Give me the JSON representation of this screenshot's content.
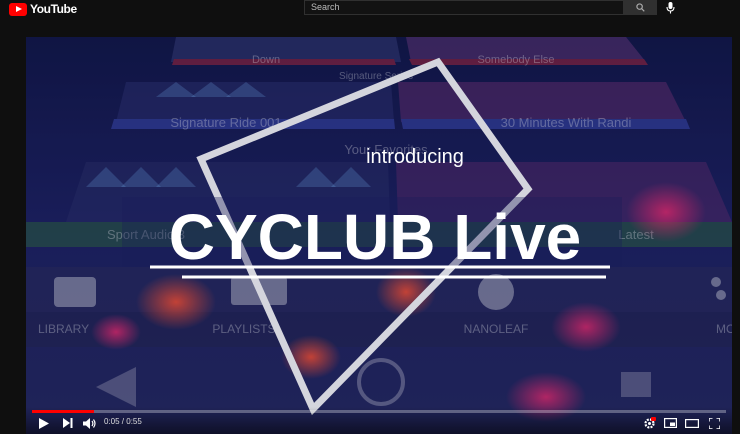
{
  "masthead": {
    "logo_text": "YouTube",
    "search_placeholder": "Search"
  },
  "player": {
    "title_small": "introducing",
    "title_large": "CYCLUB Live",
    "current_time": "0:05",
    "separator": " / ",
    "duration": "0:55",
    "progress_fraction": 0.09
  },
  "background_app": {
    "tiles": [
      "Down",
      "Somebody Else",
      "Signature Series",
      "Signature Ride 001",
      "30 Minutes With Randi",
      "Your Favorites",
      "Sport Audio 3",
      "Latest"
    ],
    "nav": [
      "LIBRARY",
      "PLAYLISTS",
      "NANOLEAF",
      "MORE"
    ]
  },
  "colors": {
    "accent": "#ff0000",
    "overlay": "#1c2060"
  },
  "icons": [
    "youtube-logo-icon",
    "search-icon",
    "mic-icon",
    "play-icon",
    "next-icon",
    "volume-icon",
    "settings-icon",
    "miniplayer-icon",
    "theater-icon",
    "fullscreen-icon"
  ]
}
